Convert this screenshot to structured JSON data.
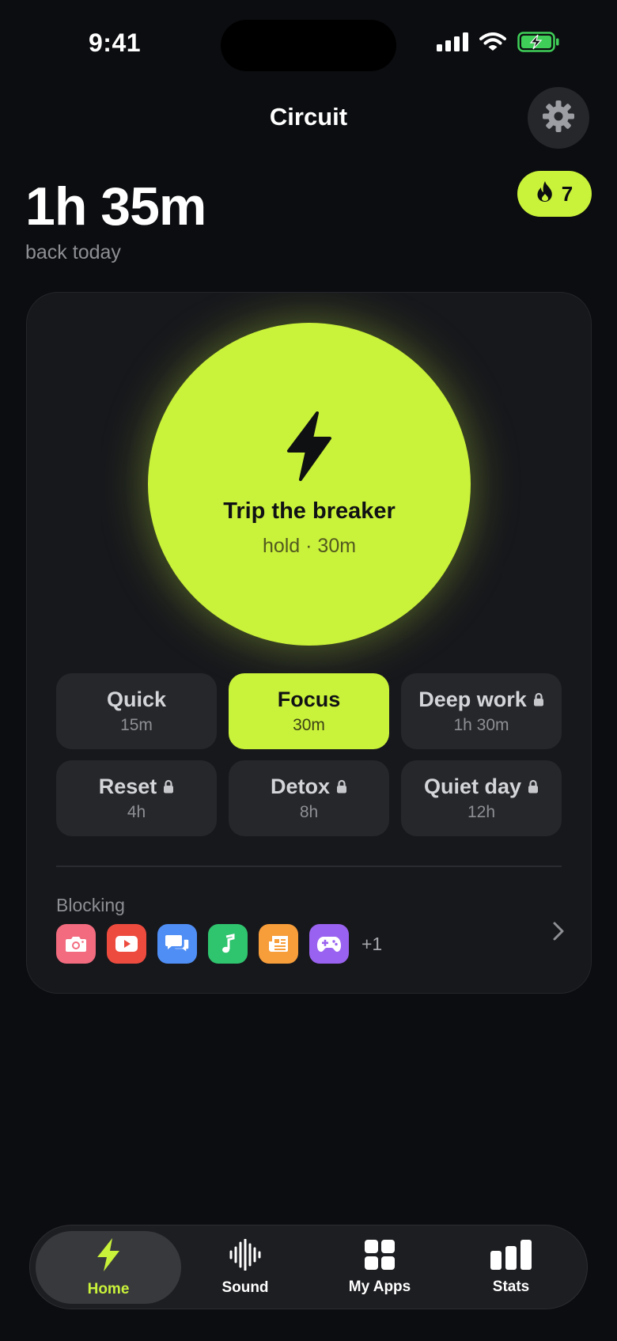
{
  "status": {
    "time": "9:41"
  },
  "header": {
    "title": "Circuit",
    "settings_icon": "gear-icon"
  },
  "summary": {
    "value": "1h 35m",
    "label": "back today"
  },
  "streak": {
    "count": "7",
    "icon": "flame-icon"
  },
  "breaker": {
    "title": "Trip the breaker",
    "subtitle": "hold · 30m",
    "icon": "lightning-icon"
  },
  "presets": [
    {
      "name": "Quick",
      "duration": "15m",
      "locked": false,
      "active": false
    },
    {
      "name": "Focus",
      "duration": "30m",
      "locked": false,
      "active": true
    },
    {
      "name": "Deep work",
      "duration": "1h 30m",
      "locked": true,
      "active": false
    },
    {
      "name": "Reset",
      "duration": "4h",
      "locked": true,
      "active": false
    },
    {
      "name": "Detox",
      "duration": "8h",
      "locked": true,
      "active": false
    },
    {
      "name": "Quiet day",
      "duration": "12h",
      "locked": true,
      "active": false
    }
  ],
  "blocking": {
    "label": "Blocking",
    "apps": [
      {
        "icon": "camera-icon",
        "color": "#f26b7f"
      },
      {
        "icon": "video-play-icon",
        "color": "#ee4b3f"
      },
      {
        "icon": "chat-bubbles-icon",
        "color": "#4f8ef5"
      },
      {
        "icon": "music-note-icon",
        "color": "#2fc46e"
      },
      {
        "icon": "news-icon",
        "color": "#f79d3a"
      },
      {
        "icon": "gamepad-icon",
        "color": "#9a62f0"
      }
    ],
    "more": "+1"
  },
  "tabs": [
    {
      "label": "Home",
      "icon": "lightning-icon",
      "active": true
    },
    {
      "label": "Sound",
      "icon": "waveform-icon",
      "active": false
    },
    {
      "label": "My Apps",
      "icon": "grid-icon",
      "active": false
    },
    {
      "label": "Stats",
      "icon": "bar-chart-icon",
      "active": false
    }
  ],
  "colors": {
    "accent": "#c9f23a",
    "background": "#0c0d10",
    "card": "#17181c"
  }
}
